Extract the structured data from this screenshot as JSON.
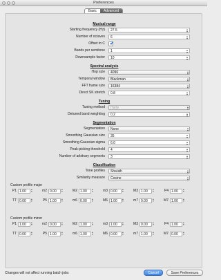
{
  "window": {
    "title": "Preferences"
  },
  "tabs": [
    "Basic",
    "Advanced"
  ],
  "sections": {
    "musical": "Musical range",
    "spectral": "Spectral analysis",
    "tuning": "Tuning",
    "segmentation": "Segmentation",
    "classification": "Classification"
  },
  "musical": {
    "start_freq_label": "Starting frequency (Hz)",
    "start_freq": "27.5",
    "octaves_label": "Number of octaves",
    "octaves": "6",
    "offset_label": "Offset to C",
    "bands_label": "Bands per semitone",
    "bands": "1",
    "downsample_label": "Downsample factor",
    "downsample": "10"
  },
  "spectral": {
    "hop_label": "Hop size",
    "hop": "4096",
    "window_label": "Temporal window",
    "window": "Blackman",
    "fft_label": "FFT frame size",
    "fft": "16384",
    "sk_label": "Direct SK stretch",
    "sk": "0.8"
  },
  "tuning": {
    "method_label": "Tuning method",
    "method": "Harte",
    "detuned_label": "Detuned band weighting",
    "detuned": "0.2"
  },
  "segmentation": {
    "seg_label": "Segmentation",
    "seg": "None",
    "gauss_size_label": "Smoothing Gaussian size",
    "gauss_size": "35",
    "gauss_sigma_label": "Smoothing Gaussian sigma",
    "gauss_sigma": "6.0",
    "peak_label": "Peak-picking threshold",
    "peak": "4",
    "arbitrary_label": "Number of arbitrary segments",
    "arbitrary": "3"
  },
  "classification": {
    "profiles_label": "Tone profiles",
    "profiles": "Sha'ath",
    "similarity_label": "Similarity measure",
    "similarity": "Cosine"
  },
  "major": {
    "title": "Custom profile major",
    "labels": [
      "P1",
      "m2",
      "M2",
      "m3",
      "M3",
      "P4",
      "TT",
      "P5",
      "m6",
      "M6",
      "m7",
      "M7"
    ],
    "values": [
      "1.00",
      "0.00",
      "1.00",
      "0.00",
      "1.00",
      "1.00",
      "0.00",
      "1.00",
      "0.00",
      "1.00",
      "0.00",
      "1.00"
    ]
  },
  "minor": {
    "title": "Custom profile minor",
    "labels": [
      "P1",
      "m2",
      "M2",
      "m3",
      "M3",
      "P4",
      "TT",
      "P5",
      "m6",
      "M6",
      "m7",
      "M7"
    ],
    "values": [
      "1.00",
      "0.00",
      "1.00",
      "1.00",
      "0.00",
      "1.00",
      "0.00",
      "1.00",
      "1.00",
      "0.00",
      "1.00",
      "0.00"
    ]
  },
  "footer": {
    "note": "Changes will not affect running batch jobs",
    "cancel": "Cancel",
    "save": "Save Preferences"
  }
}
